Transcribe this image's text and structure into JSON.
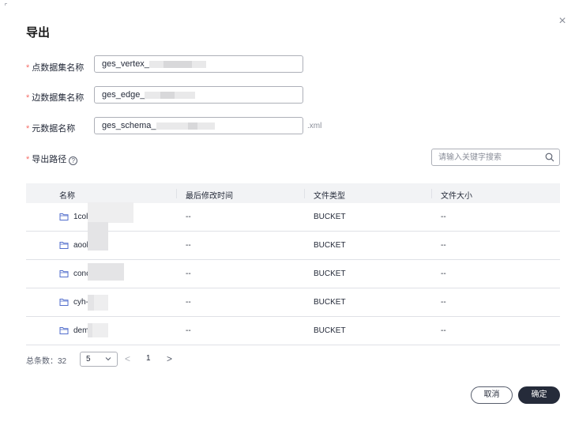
{
  "dialog": {
    "title": "导出",
    "close_glyph": "×"
  },
  "form": {
    "vertex": {
      "label": "点数据集名称",
      "value": "ges_vertex_"
    },
    "edge": {
      "label": "边数据集名称",
      "value": "ges_edge_"
    },
    "schema": {
      "label": "元数据名称",
      "value": "ges_schema_",
      "suffix": ".xml"
    },
    "path": {
      "label": "导出路径",
      "help_glyph": "?"
    },
    "required_mark": "*"
  },
  "search": {
    "placeholder": "请输入关键字搜索",
    "value": "",
    "icon": "search-icon"
  },
  "table": {
    "columns": [
      "名称",
      "最后修改时间",
      "文件类型",
      "文件大小"
    ],
    "rows": [
      {
        "name": "1col",
        "modified": "--",
        "type": "BUCKET",
        "size": "--"
      },
      {
        "name": "aool",
        "modified": "--",
        "type": "BUCKET",
        "size": "--"
      },
      {
        "name": "conc",
        "modified": "--",
        "type": "BUCKET",
        "size": "--"
      },
      {
        "name": "cyh-",
        "modified": "--",
        "type": "BUCKET",
        "size": "--"
      },
      {
        "name": "dem",
        "modified": "--",
        "type": "BUCKET",
        "size": "--"
      }
    ]
  },
  "pagination": {
    "total_label": "总条数：32",
    "page_size": "5",
    "prev_glyph": "<",
    "current_page": "1",
    "next_glyph": ">"
  },
  "buttons": {
    "cancel": "取消",
    "ok": "确定"
  },
  "colors": {
    "accent": "#252b3a",
    "required": "#f66f6a",
    "border": "#adb0b8",
    "header_bg": "#f2f3f5"
  }
}
